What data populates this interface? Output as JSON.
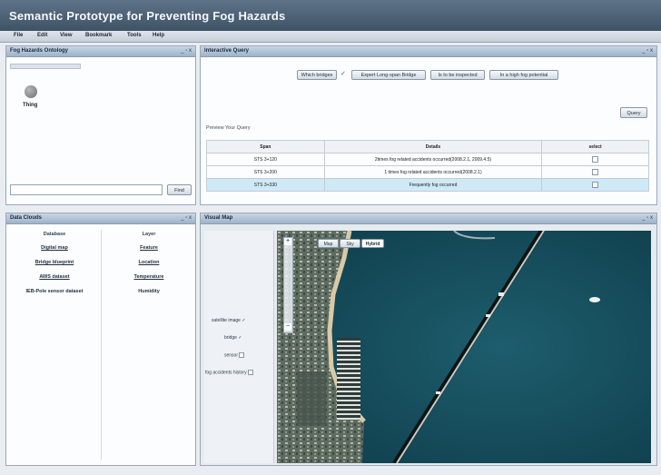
{
  "app": {
    "title": "Semantic Prototype for Preventing Fog Hazards"
  },
  "menu": [
    "File",
    "Edit",
    "View",
    "Bookmark",
    "Tools",
    "Help"
  ],
  "ontology": {
    "title": "Fog Hazards Ontology",
    "controls": "_ ▫ x",
    "node_label": "Thing",
    "find_placeholder": "",
    "find_label": "Find"
  },
  "query": {
    "title": "Interactive Query",
    "controls": "_ ▫ x",
    "chips": [
      "Which bridges",
      "Expert Long-span Bridge",
      "Is to be inspected",
      "In a high fog potential"
    ],
    "chip_check": "✓",
    "query_button": "Query",
    "preview_label": "Preview Your Query",
    "columns": [
      "Span",
      "Details",
      "select"
    ],
    "rows": [
      {
        "span": "STS 3+120",
        "details": "2times fog related accidents occurred(2008.2.1, 2009.4.5)"
      },
      {
        "span": "STS 3+200",
        "details": "1 times fog related accidents occurred(2008.2.1)"
      },
      {
        "span": "STS 3+330",
        "details": "Frequently fog occurred"
      }
    ]
  },
  "data_clouds": {
    "title": "Data Clouds",
    "controls": "_ ▫ x",
    "database_header": "Database",
    "layer_header": "Layer",
    "database_items": [
      "Digital map",
      "Bridge blueprint",
      "AWS dataset",
      "IEB-Pole sensor dataset"
    ],
    "layer_items": [
      "Feature",
      "Location",
      "Temperature",
      "Humidity"
    ]
  },
  "visual_map": {
    "title": "Visual Map",
    "controls": "_ ▫ x",
    "zoom_in": "+",
    "zoom_out": "−",
    "map_types": [
      "Map",
      "Sky",
      "Hybrid"
    ],
    "active_map_type": 2,
    "layers": [
      {
        "label": "satellite image",
        "checked": true
      },
      {
        "label": "bridge",
        "checked": true
      },
      {
        "label": "sensor",
        "checked": false
      },
      {
        "label": "fog accidents history",
        "checked": false
      }
    ]
  }
}
